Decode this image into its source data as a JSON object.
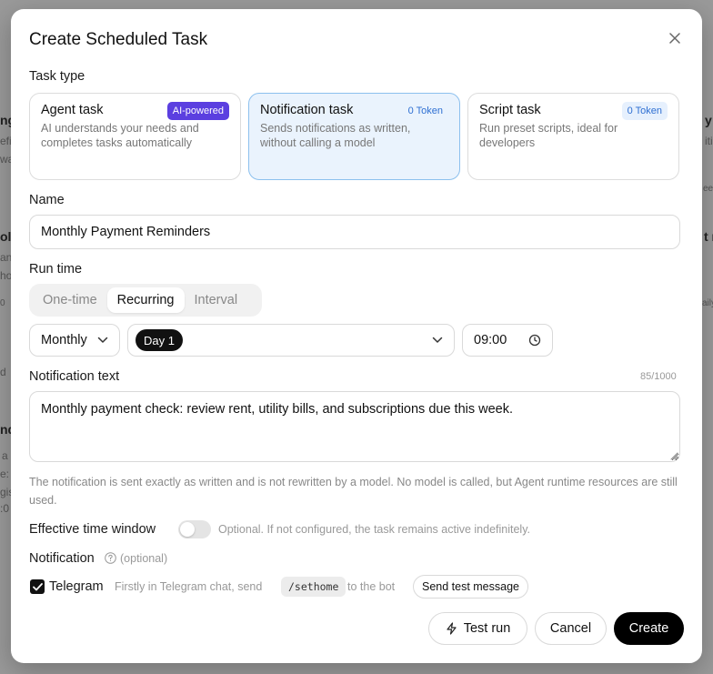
{
  "background": {
    "fragments": [
      "ng",
      "efi",
      "wa",
      "y",
      "iti",
      "eek",
      "ola",
      "an",
      "ho",
      "0",
      "t r",
      "aily",
      "d",
      "nd",
      "a",
      "e:",
      "gis",
      ":0"
    ]
  },
  "modal": {
    "title": "Create Scheduled Task",
    "task_type": {
      "label": "Task type",
      "cards": [
        {
          "title": "Agent task",
          "badge": "AI-powered",
          "description": "AI understands your needs and completes tasks automatically",
          "selected": false
        },
        {
          "title": "Notification task",
          "badge": "0 Token",
          "description": "Sends notifications as written, without calling a model",
          "selected": true
        },
        {
          "title": "Script task",
          "badge": "0 Token",
          "description": "Run preset scripts, ideal for developers",
          "selected": false
        }
      ]
    },
    "name": {
      "label": "Name",
      "value": "Monthly Payment Reminders"
    },
    "run_time": {
      "label": "Run time",
      "modes": [
        "One-time",
        "Recurring",
        "Interval"
      ],
      "active_mode": "Recurring",
      "frequency": "Monthly",
      "day": "Day 1",
      "time": "09:00"
    },
    "notification_text": {
      "label": "Notification text",
      "counter": "85/1000",
      "value": "Monthly payment check: review rent, utility bills, and subscriptions due this week.",
      "helper": "The notification is sent exactly as written and is not rewritten by a model. No model is called, but Agent runtime resources are still used."
    },
    "effective_window": {
      "label": "Effective time window",
      "enabled": false,
      "hint": "Optional. If not configured, the task remains active indefinitely."
    },
    "notification": {
      "label": "Notification",
      "optional": "(optional)",
      "channel": "Telegram",
      "checked": true,
      "instruction_before": "Firstly in Telegram chat, send",
      "command": "/sethome",
      "instruction_after": "to the bot",
      "test_button": "Send test message"
    },
    "actions": {
      "test_run": "Test run",
      "cancel": "Cancel",
      "create": "Create"
    }
  },
  "colors": {
    "accent": "#5b3fe0",
    "selected_card_bg": "#eaf3fd",
    "selected_card_border": "#8cc0ee",
    "token_badge": "#2e6fd2",
    "primary_button": "#000000"
  }
}
